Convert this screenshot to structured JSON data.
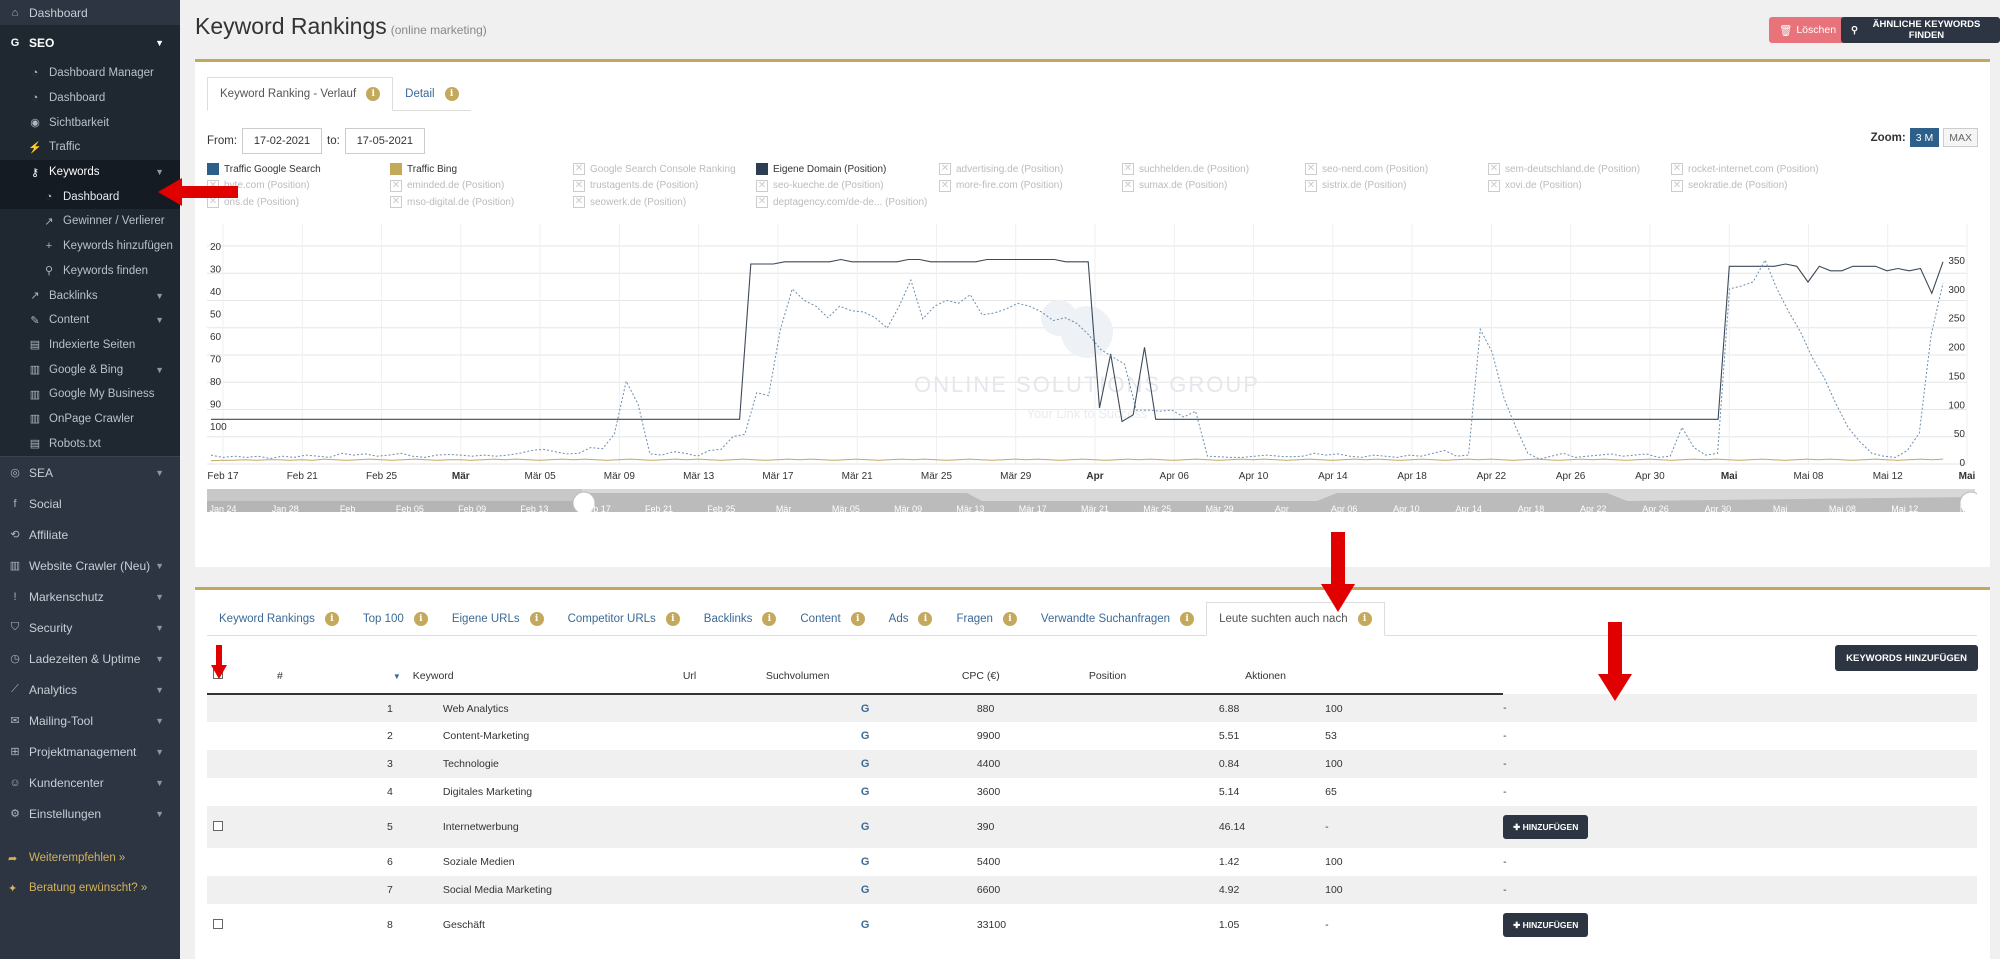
{
  "sidebar": {
    "dashboard": "Dashboard",
    "seo": "SEO",
    "seo_items": [
      {
        "label": "Dashboard Manager"
      },
      {
        "label": "Dashboard"
      },
      {
        "label": "Sichtbarkeit"
      },
      {
        "label": "Traffic"
      },
      {
        "label": "Keywords"
      },
      {
        "label": "Backlinks"
      },
      {
        "label": "Content"
      },
      {
        "label": "Indexierte Seiten"
      },
      {
        "label": "Google & Bing"
      },
      {
        "label": "Google My Business"
      },
      {
        "label": "OnPage Crawler"
      },
      {
        "label": "Robots.txt"
      }
    ],
    "keywords_items": [
      "Dashboard",
      "Gewinner / Verlierer",
      "Keywords hinzufügen",
      "Keywords finden"
    ],
    "main_items": [
      "SEA",
      "Social",
      "Affiliate",
      "Website Crawler (Neu)",
      "Markenschutz",
      "Security",
      "Ladezeiten & Uptime",
      "Analytics",
      "Mailing-Tool",
      "Projektmanagement",
      "Kundencenter",
      "Einstellungen"
    ],
    "promo1": "Weiterempfehlen »",
    "promo2": "Beratung erwünscht? »"
  },
  "header": {
    "title": "Keyword Rankings",
    "subtitle": "(online marketing)",
    "delete_label": "Löschen",
    "similar_label": "ÄHNLICHE KEYWORDS FINDEN"
  },
  "top_tabs": [
    "Keyword Ranking - Verlauf",
    "Detail"
  ],
  "date_range": {
    "from_label": "From:",
    "from": "17-02-2021",
    "to_label": "to:",
    "to": "17-05-2021"
  },
  "zoom": {
    "label": "Zoom:",
    "options": [
      "3 M",
      "MAX"
    ],
    "selected": "3 M"
  },
  "legend": [
    {
      "label": "Traffic Google Search",
      "color": "#2c5f8a",
      "active": true
    },
    {
      "label": "Traffic Bing",
      "color": "#c4a95c",
      "active": true
    },
    {
      "label": "Google Search Console Ranking",
      "active": false
    },
    {
      "label": "Eigene Domain (Position)",
      "color": "#2c3e50",
      "active": true
    },
    {
      "label": "advertising.de (Position)",
      "active": false
    },
    {
      "label": "suchhelden.de (Position)",
      "active": false
    },
    {
      "label": "seo-nerd.com (Position)",
      "active": false
    },
    {
      "label": "sem-deutschland.de (Position)",
      "active": false
    },
    {
      "label": "rocket-internet.com (Position)",
      "active": false
    },
    {
      "label": "byte.com (Position)",
      "active": false
    },
    {
      "label": "eminded.de (Position)",
      "active": false
    },
    {
      "label": "trustagents.de (Position)",
      "active": false
    },
    {
      "label": "seo-kueche.de (Position)",
      "active": false
    },
    {
      "label": "more-fire.com (Position)",
      "active": false
    },
    {
      "label": "sumax.de (Position)",
      "active": false
    },
    {
      "label": "sistrix.de (Position)",
      "active": false
    },
    {
      "label": "xovi.de (Position)",
      "active": false
    },
    {
      "label": "seokratie.de (Position)",
      "active": false
    },
    {
      "label": "ons.de (Position)",
      "active": false
    },
    {
      "label": "mso-digital.de (Position)",
      "active": false
    },
    {
      "label": "seowerk.de (Position)",
      "active": false
    },
    {
      "label": "deptagency.com/de-de... (Position)",
      "active": false
    }
  ],
  "chart_data": {
    "type": "line",
    "watermark": "ONLINE SOLUTIONS GROUP",
    "watermark_tagline": "Your Link to Success",
    "x_ticks": [
      "Feb 17",
      "Feb 21",
      "Feb 25",
      "Mär",
      "Mär 05",
      "Mär 09",
      "Mär 13",
      "Mär 17",
      "Mär 21",
      "Mär 25",
      "Mär 29",
      "Apr",
      "Apr 06",
      "Apr 10",
      "Apr 14",
      "Apr 18",
      "Apr 22",
      "Apr 26",
      "Apr 30",
      "Mai",
      "Mai 08",
      "Mai 12",
      "Mai"
    ],
    "y_left_ticks": [
      "20",
      "30",
      "40",
      "50",
      "60",
      "70",
      "80",
      "90",
      "100"
    ],
    "y_left_range": [
      20,
      100
    ],
    "y_right_ticks": [
      "0",
      "50",
      "100",
      "150",
      "200",
      "250",
      "300",
      "350"
    ],
    "y_right_range": [
      0,
      350
    ],
    "series": [
      {
        "name": "Eigene Domain (Position)",
        "axis": "left",
        "values": [
          97,
          97,
          97,
          97,
          97,
          97,
          97,
          97,
          97,
          97,
          97,
          97,
          97,
          97,
          97,
          97,
          97,
          97,
          97,
          97,
          97,
          97,
          97,
          97,
          97,
          97,
          97,
          97,
          97,
          97,
          97,
          97,
          97,
          97,
          97,
          97,
          97,
          97,
          97,
          97,
          97,
          97,
          97,
          97,
          97,
          97,
          97,
          97,
          28,
          28,
          28,
          27,
          27,
          27,
          27,
          27,
          26,
          27,
          27,
          27,
          27,
          27,
          26,
          26,
          27,
          27,
          27,
          27,
          27,
          26,
          26,
          26,
          26,
          26,
          26,
          26,
          27,
          27,
          27,
          92,
          68,
          98,
          95,
          65,
          97,
          97,
          97,
          97,
          97,
          97,
          97,
          97,
          97,
          97,
          97,
          97,
          97,
          97,
          97,
          97,
          97,
          97,
          97,
          97,
          97,
          97,
          97,
          97,
          97,
          97,
          97,
          97,
          97,
          97,
          97,
          97,
          97,
          97,
          97,
          97,
          97,
          97,
          97,
          97,
          97,
          97,
          97,
          97,
          97,
          97,
          97,
          97,
          97,
          97,
          97,
          29,
          29,
          29,
          29,
          29,
          28,
          29,
          36,
          29,
          31,
          31,
          29,
          29,
          29,
          31,
          30,
          31,
          30,
          41,
          27
        ]
      },
      {
        "name": "Traffic Google Search",
        "axis": "right",
        "values": [
          12,
          8,
          10,
          8,
          10,
          6,
          10,
          8,
          12,
          10,
          8,
          15,
          12,
          14,
          10,
          12,
          15,
          10,
          8,
          12,
          13,
          12,
          10,
          12,
          10,
          12,
          15,
          20,
          22,
          18,
          14,
          15,
          25,
          23,
          48,
          140,
          100,
          14,
          12,
          18,
          15,
          10,
          20,
          22,
          44,
          48,
          120,
          115,
          230,
          300,
          280,
          270,
          250,
          270,
          262,
          260,
          250,
          232,
          270,
          315,
          248,
          270,
          280,
          275,
          290,
          255,
          258,
          265,
          275,
          270,
          260,
          245,
          250,
          240,
          220,
          195,
          182,
          170,
          90,
          90,
          88,
          90,
          78,
          88,
          10,
          9,
          8,
          8,
          10,
          12,
          10,
          9,
          10,
          15,
          12,
          14,
          10,
          8,
          12,
          10,
          8,
          12,
          10,
          15,
          20,
          10,
          12,
          230,
          190,
          110,
          60,
          15,
          5,
          10,
          15,
          8,
          10,
          12,
          14,
          10,
          12,
          14,
          8,
          10,
          60,
          25,
          12,
          15,
          300,
          305,
          312,
          350,
          300,
          260,
          225,
          180,
          145,
          100,
          60,
          35,
          15,
          10,
          8,
          20,
          50,
          220,
          310
        ]
      },
      {
        "name": "Traffic Bing",
        "axis": "right",
        "values": [
          2,
          3,
          3,
          4,
          3,
          4,
          4,
          3,
          4,
          3,
          5,
          4,
          3,
          4,
          5,
          4,
          3,
          4,
          5,
          4,
          3,
          4,
          4,
          3,
          4,
          5,
          4,
          5,
          4,
          3,
          4,
          5,
          4,
          5,
          4,
          3,
          4,
          5,
          4,
          3,
          4,
          5,
          4,
          5,
          4,
          3,
          4,
          5,
          4,
          3,
          4,
          5,
          4,
          5,
          4,
          3,
          4,
          5,
          4,
          3,
          4,
          5,
          4,
          5,
          4,
          3,
          4,
          5,
          4,
          3,
          4,
          5,
          4,
          5,
          4,
          3,
          4,
          5,
          4,
          3,
          4,
          5,
          4,
          5,
          4,
          3,
          4,
          5,
          4,
          3,
          4,
          5,
          4,
          5,
          4,
          3,
          4,
          5,
          4,
          3,
          4,
          5,
          4,
          5,
          4,
          3,
          4,
          5,
          4,
          3,
          4,
          5,
          4,
          5,
          4,
          3,
          4,
          5,
          4,
          3,
          4,
          5,
          4,
          5,
          4,
          3,
          4,
          5,
          4,
          3,
          4,
          5,
          4,
          5,
          4,
          3,
          4,
          5,
          4,
          3,
          4,
          5,
          4,
          5,
          4,
          3,
          4,
          5,
          4,
          3,
          4,
          5,
          4,
          5
        ]
      }
    ],
    "navigator_ticks": [
      "Jan 24",
      "Jan 28",
      "Feb",
      "Feb 05",
      "Feb 09",
      "Feb 13",
      "Feb 17",
      "Feb 21",
      "Feb 25",
      "Mär",
      "Mär 05",
      "Mär 09",
      "Mär 13",
      "Mär 17",
      "Mär 21",
      "Mär 25",
      "Mär 29",
      "Apr",
      "Apr 06",
      "Apr 10",
      "Apr 14",
      "Apr 18",
      "Apr 22",
      "Apr 26",
      "Apr 30",
      "Mai",
      "Mai 08",
      "Mai 12",
      "Mai"
    ]
  },
  "bottom_tabs": [
    "Keyword Rankings",
    "Top 100",
    "Eigene URLs",
    "Competitor URLs",
    "Backlinks",
    "Content",
    "Ads",
    "Fragen",
    "Verwandte Suchanfragen",
    "Leute suchten auch nach"
  ],
  "add_keywords_label": "KEYWORDS HINZUFÜGEN",
  "table": {
    "headers": [
      "#",
      "Keyword",
      "Url",
      "Suchvolumen",
      "CPC (€)",
      "Position",
      "Aktionen"
    ],
    "add_label": "HINZUFÜGEN",
    "rows": [
      {
        "num": "1",
        "keyword": "Web Analytics",
        "engine": "G",
        "volume": "880",
        "cpc": "6.88",
        "position": "100",
        "action": "-",
        "checkbox": false
      },
      {
        "num": "2",
        "keyword": "Content-Marketing",
        "engine": "G",
        "volume": "9900",
        "cpc": "5.51",
        "position": "53",
        "action": "-",
        "checkbox": false
      },
      {
        "num": "3",
        "keyword": "Technologie",
        "engine": "G",
        "volume": "4400",
        "cpc": "0.84",
        "position": "100",
        "action": "-",
        "checkbox": false
      },
      {
        "num": "4",
        "keyword": "Digitales Marketing",
        "engine": "G",
        "volume": "3600",
        "cpc": "5.14",
        "position": "65",
        "action": "-",
        "checkbox": false
      },
      {
        "num": "5",
        "keyword": "Internetwerbung",
        "engine": "G",
        "volume": "390",
        "cpc": "46.14",
        "position": "-",
        "action": "HINZUFÜGEN",
        "checkbox": true
      },
      {
        "num": "6",
        "keyword": "Soziale Medien",
        "engine": "G",
        "volume": "5400",
        "cpc": "1.42",
        "position": "100",
        "action": "-",
        "checkbox": false
      },
      {
        "num": "7",
        "keyword": "Social Media Marketing",
        "engine": "G",
        "volume": "6600",
        "cpc": "4.92",
        "position": "100",
        "action": "-",
        "checkbox": false
      },
      {
        "num": "8",
        "keyword": "Geschäft",
        "engine": "G",
        "volume": "33100",
        "cpc": "1.05",
        "position": "-",
        "action": "HINZUFÜGEN",
        "checkbox": true
      }
    ]
  }
}
